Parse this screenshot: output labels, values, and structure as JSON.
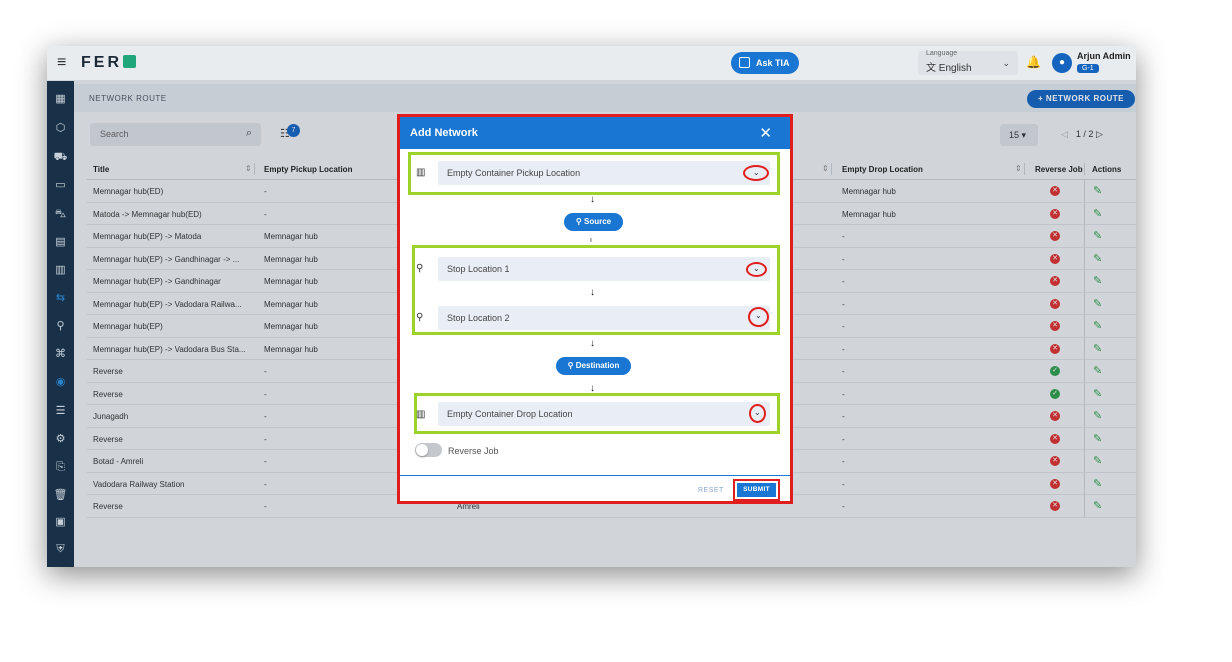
{
  "topbar": {
    "logo": "FER",
    "ask_tia": "Ask TIA",
    "language_label": "Language",
    "language_value": "English",
    "user_name": "Arjun Admin",
    "user_badge": "G-1"
  },
  "breadcrumb": "NETWORK ROUTE",
  "add_button": "+ NETWORK ROUTE",
  "search": {
    "placeholder": "Search"
  },
  "filter_count": "7",
  "pagination": {
    "page_size": "15",
    "page": "1 / 2"
  },
  "table": {
    "headers": [
      "Title",
      "Empty Pickup Location",
      "Empty Drop Location",
      "Reverse Job",
      "Actions"
    ],
    "rows": [
      {
        "title": "Memnagar hub(ED)",
        "pickup": "-",
        "mid": "",
        "drop": "Memnagar hub",
        "status": "red"
      },
      {
        "title": "Matoda -> Memnagar hub(ED)",
        "pickup": "-",
        "mid": "",
        "drop": "Memnagar hub",
        "status": "red"
      },
      {
        "title": "Memnagar hub(EP) -> Matoda",
        "pickup": "Memnagar hub",
        "mid": "",
        "drop": "-",
        "status": "red"
      },
      {
        "title": "Memnagar hub(EP) -> Gandhinagar -> ...",
        "pickup": "Memnagar hub",
        "mid": "",
        "drop": "-",
        "status": "red"
      },
      {
        "title": "Memnagar hub(EP) -> Gandhinagar",
        "pickup": "Memnagar hub",
        "mid": "",
        "drop": "-",
        "status": "red"
      },
      {
        "title": "Memnagar hub(EP) -> Vadodara Railwa...",
        "pickup": "Memnagar hub",
        "mid": "",
        "drop": "-",
        "status": "red"
      },
      {
        "title": "Memnagar hub(EP)",
        "pickup": "Memnagar hub",
        "mid": "",
        "drop": "-",
        "status": "red"
      },
      {
        "title": "Memnagar hub(EP) -> Vadodara Bus Sta...",
        "pickup": "Memnagar hub",
        "mid": "",
        "drop": "-",
        "status": "red"
      },
      {
        "title": "Reverse",
        "pickup": "-",
        "mid": "",
        "drop": "-",
        "status": "green"
      },
      {
        "title": "Reverse",
        "pickup": "-",
        "mid": "",
        "drop": "-",
        "status": "green"
      },
      {
        "title": "Junagadh",
        "pickup": "-",
        "mid": "",
        "drop": "-",
        "status": "red"
      },
      {
        "title": "Reverse",
        "pickup": "-",
        "mid": "",
        "drop": "-",
        "status": "red"
      },
      {
        "title": "Botad - Amreli",
        "pickup": "-",
        "mid": "",
        "drop": "-",
        "status": "red"
      },
      {
        "title": "Vadodara Railway Station",
        "pickup": "-",
        "mid": "",
        "drop": "-",
        "status": "red"
      },
      {
        "title": "Reverse",
        "pickup": "-",
        "mid": "Amreli",
        "drop": "-",
        "status": "red"
      }
    ]
  },
  "modal": {
    "title": "Add Network",
    "pickup_placeholder": "Empty Container Pickup Location",
    "source_label": "Source",
    "stop1_placeholder": "Stop Location 1",
    "stop2_placeholder": "Stop Location 2",
    "destination_label": "Destination",
    "drop_placeholder": "Empty Container Drop Location",
    "reverse_job_label": "Reverse Job",
    "reset_label": "RESET",
    "submit_label": "SUBMIT"
  },
  "colors": {
    "primary": "#1976d2",
    "sidebar": "#18334b",
    "highlight_red": "#e01e1e",
    "highlight_green": "#9cd329",
    "status_red": "#d83030",
    "status_green": "#2e9d4a"
  }
}
